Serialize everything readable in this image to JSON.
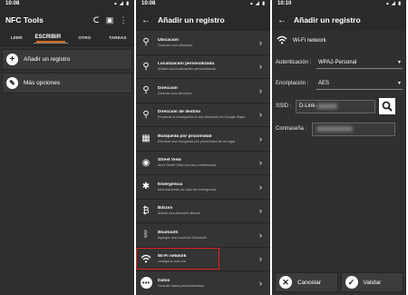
{
  "screen1": {
    "status_time": "10:08",
    "title": "NFC Tools",
    "tabs": [
      "LEER",
      "ESCRIBIR",
      "OTRO",
      "TAREAS"
    ],
    "actions": [
      {
        "label": "Añadir un registro",
        "icon": "plus-icon"
      },
      {
        "label": "Más opciones",
        "icon": "wrench-icon"
      }
    ]
  },
  "screen2": {
    "status_time": "10:08",
    "title": "Añadir un registro",
    "items": [
      {
        "title": "Ubicación",
        "subtitle": "Guardar una ubicación",
        "icon": "location-icon"
      },
      {
        "title": "Localización personalizada",
        "subtitle": "Añadir una localización personalizada",
        "icon": "location-icon"
      },
      {
        "title": "Dirección",
        "subtitle": "Guardar una dirección",
        "icon": "location-icon"
      },
      {
        "title": "Dirección de destino",
        "subtitle": "Empezar la navegación a una ubicación en Google Maps",
        "icon": "location-icon"
      },
      {
        "title": "Búsqueda por proximidad",
        "subtitle": "Efectuar una búsqueda por proximidad de un lugar",
        "icon": "map-icon"
      },
      {
        "title": "Street View",
        "subtitle": "Abrir Street View con las coordenadas",
        "icon": "eye-icon"
      },
      {
        "title": "Emergencia",
        "subtitle": "Informaciones en caso de emergencia",
        "icon": "asterisk-icon"
      },
      {
        "title": "Bitcoin",
        "subtitle": "Añadir una dirección Bitcoin",
        "icon": "bitcoin-icon"
      },
      {
        "title": "Bluetooth",
        "subtitle": "Agregar una conexión Bluetooth",
        "icon": "bluetooth-icon"
      },
      {
        "title": "Wi-Fi network",
        "subtitle": "configurar una red",
        "icon": "wifi-icon"
      },
      {
        "title": "Datos",
        "subtitle": "Guardar datos personalizados",
        "icon": "dots-icon"
      }
    ]
  },
  "screen3": {
    "status_time": "10:10",
    "title": "Añadir un registro",
    "header": "Wi-Fi network",
    "auth_label": "Autenticación :",
    "auth_value": "WPA2-Personal",
    "enc_label": "Encriptación :",
    "enc_value": "AES",
    "ssid_label": "SSID :",
    "ssid_value": "D-Link-",
    "pass_label": "Contraseña :",
    "cancel_label": "Cancelar",
    "validate_label": "Validar"
  }
}
